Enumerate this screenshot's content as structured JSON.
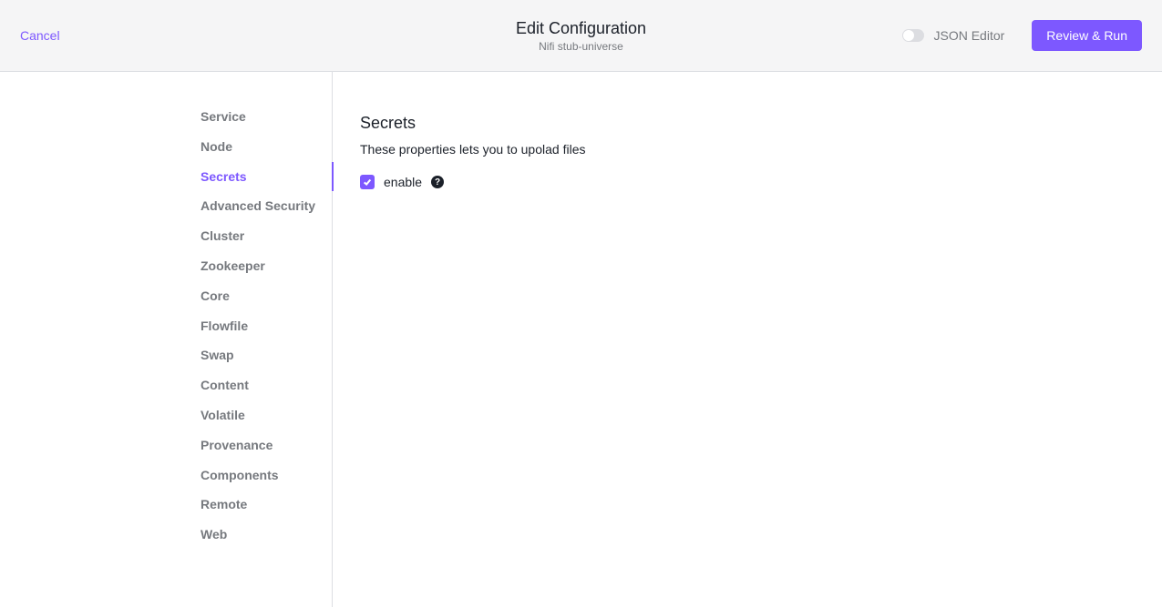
{
  "header": {
    "cancel": "Cancel",
    "title": "Edit Configuration",
    "subtitle": "Nifi stub-universe",
    "jsonEditorLabel": "JSON Editor",
    "reviewRun": "Review & Run"
  },
  "sidebar": {
    "items": [
      {
        "label": "Service",
        "active": false
      },
      {
        "label": "Node",
        "active": false
      },
      {
        "label": "Secrets",
        "active": true
      },
      {
        "label": "Advanced Security",
        "active": false
      },
      {
        "label": "Cluster",
        "active": false
      },
      {
        "label": "Zookeeper",
        "active": false
      },
      {
        "label": "Core",
        "active": false
      },
      {
        "label": "Flowfile",
        "active": false
      },
      {
        "label": "Swap",
        "active": false
      },
      {
        "label": "Content",
        "active": false
      },
      {
        "label": "Volatile",
        "active": false
      },
      {
        "label": "Provenance",
        "active": false
      },
      {
        "label": "Components",
        "active": false
      },
      {
        "label": "Remote",
        "active": false
      },
      {
        "label": "Web",
        "active": false
      }
    ]
  },
  "main": {
    "title": "Secrets",
    "description": "These properties lets you to upolad files",
    "enableLabel": "enable",
    "enableChecked": true,
    "helpGlyph": "?"
  },
  "colors": {
    "accent": "#7d58ff"
  }
}
